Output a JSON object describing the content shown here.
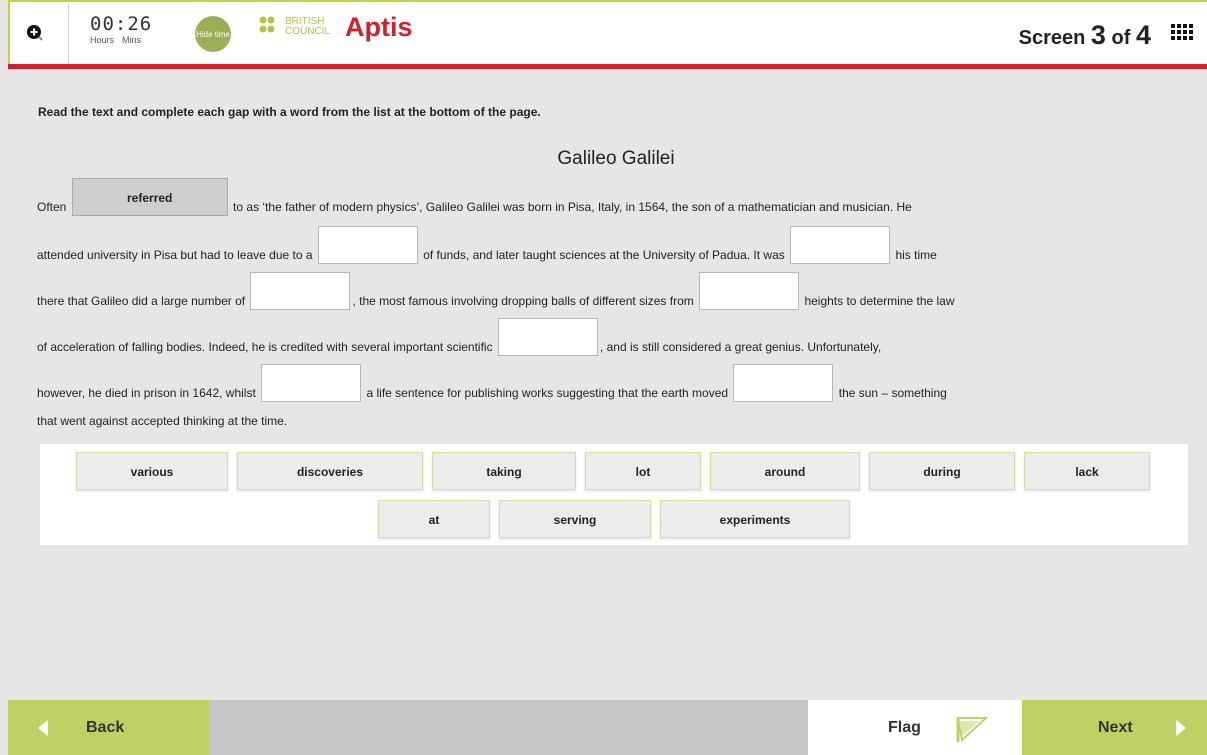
{
  "header": {
    "timer": {
      "time": "00:26",
      "hours_label": "Hours",
      "mins_label": "Mins"
    },
    "hide_time_label": "Hide time",
    "logo": {
      "brand_line1": "BRITISH",
      "brand_line2": "COUNCIL",
      "product": "Aptis"
    },
    "screen": {
      "prefix": "Screen",
      "current": "3",
      "of": "of",
      "total": "4"
    },
    "accent_color": "#c9d33a",
    "brand_red": "#d3202a"
  },
  "instructions": "Read the text and complete each gap with a word from the list at the bottom of the page.",
  "passage": {
    "title": "Galileo Galilei",
    "gap1_value": "referred",
    "segments": [
      "Often",
      "to as ‘the father of modern physics’, Galileo Galilei was born in Pisa, Italy, in 1564, the son of a mathematician and musician. He",
      "attended university in Pisa but had to leave due to a",
      "of funds, and later taught sciences at the University of Padua. It was",
      "his time",
      "there that Galileo did a large number of",
      ", the most famous involving dropping balls of different sizes from",
      "heights to determine the law",
      "of acceleration of falling bodies. Indeed, he is credited with several important scientific",
      ", and is still considered a great genius. Unfortunately,",
      "however, he died in prison in 1642, whilst",
      "a life sentence for publishing works suggesting that the earth moved",
      "the sun – something",
      "that went against accepted thinking at the time."
    ]
  },
  "word_bank": [
    "various",
    "discoveries",
    "taking",
    "lot",
    "around",
    "during",
    "lack",
    "at",
    "serving",
    "experiments"
  ],
  "footer": {
    "back": "Back",
    "flag": "Flag",
    "next": "Next",
    "green": "#bfd165"
  }
}
